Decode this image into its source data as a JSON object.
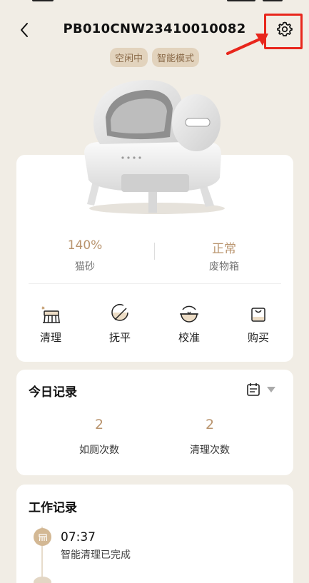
{
  "header": {
    "title": "PB010CNW23410010082",
    "back_icon": "chevron-left-icon",
    "settings_icon": "gear-icon"
  },
  "badges": [
    "空闲中",
    "智能模式"
  ],
  "status": {
    "litter": {
      "value": "140%",
      "label": "猫砂"
    },
    "waste_bin": {
      "value": "正常",
      "label": "废物箱"
    }
  },
  "actions": [
    {
      "label": "清理",
      "icon": "broom-icon"
    },
    {
      "label": "抚平",
      "icon": "level-icon"
    },
    {
      "label": "校准",
      "icon": "calibrate-icon"
    },
    {
      "label": "购买",
      "icon": "shopping-bag-icon"
    }
  ],
  "today": {
    "title": "今日记录",
    "calendar_icon": "calendar-icon",
    "toilet_count": {
      "value": "2",
      "label": "如厕次数"
    },
    "clean_count": {
      "value": "2",
      "label": "清理次数"
    }
  },
  "work": {
    "title": "工作记录",
    "entries": [
      {
        "time": "07:37",
        "desc": "智能清理已完成"
      }
    ]
  },
  "colors": {
    "accent": "#b9946e",
    "badge_bg": "#e2d3bd",
    "annotation": "#e8261c",
    "background": "#f1ede5"
  }
}
